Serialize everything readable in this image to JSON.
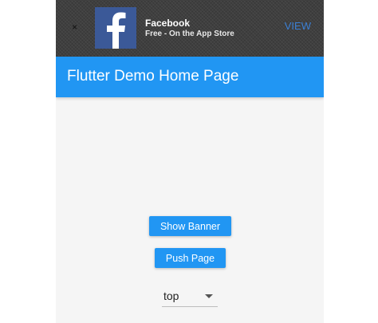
{
  "smart_banner": {
    "close_label": "×",
    "app_icon": "facebook-logo-icon",
    "app_name": "Facebook",
    "app_subtitle": "Free - On the App Store",
    "view_label": "VIEW"
  },
  "app_bar": {
    "title": "Flutter Demo Home Page"
  },
  "main": {
    "show_banner_label": "Show Banner",
    "push_page_label": "Push Page",
    "position_dropdown": {
      "selected": "top"
    }
  },
  "colors": {
    "primary": "#2196f3",
    "banner_background": "#3f3f3f",
    "facebook_blue": "#3b5998",
    "view_link": "#3b7fd4",
    "page_background": "#f5f5f5"
  }
}
